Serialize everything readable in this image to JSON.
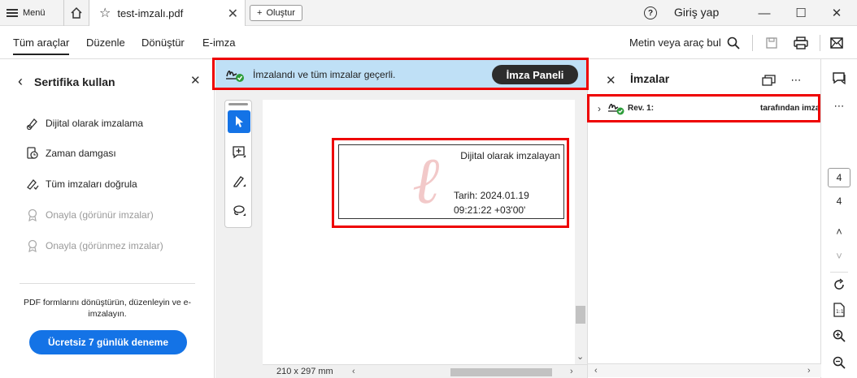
{
  "titlebar": {
    "menu_label": "Menü",
    "tab_title": "test-imzalı.pdf",
    "create_label": "Oluştur",
    "login_label": "Giriş yap"
  },
  "toolbar": {
    "tabs": [
      "Tüm araçlar",
      "Düzenle",
      "Dönüştür",
      "E-imza"
    ],
    "find_label": "Metin veya araç bul"
  },
  "left_panel": {
    "title": "Sertifika kullan",
    "items": [
      {
        "label": "Dijital olarak imzalama",
        "icon": "pen-certificate-icon",
        "enabled": true
      },
      {
        "label": "Zaman damgası",
        "icon": "timestamp-icon",
        "enabled": true
      },
      {
        "label": "Tüm imzaları doğrula",
        "icon": "verify-signature-icon",
        "enabled": true
      },
      {
        "label": "Onayla (görünür imzalar)",
        "icon": "certify-visible-icon",
        "enabled": false
      },
      {
        "label": "Onayla (görünmez imzalar)",
        "icon": "certify-invisible-icon",
        "enabled": false
      }
    ],
    "promo_text": "PDF formlarını dönüştürün, düzenleyin ve e-imzalayın.",
    "trial_button": "Ücretsiz 7 günlük deneme"
  },
  "banner": {
    "message": "İmzalandı ve tüm imzalar geçerli.",
    "button": "İmza Paneli"
  },
  "signature_field": {
    "line1": "Dijital olarak imzalayan",
    "line2": "Tarih: 2024.01.19",
    "line3": "09:21:22 +03'00'"
  },
  "status": {
    "page_size": "210 x 297 mm"
  },
  "signatures_panel": {
    "title": "İmzalar",
    "rev_label": "Rev. 1:",
    "rev_by": "tarafından imzalandı"
  },
  "rail": {
    "current_page": "4",
    "total_pages": "4"
  },
  "colors": {
    "accent": "#1473e6",
    "banner_bg": "#bfe0f6",
    "highlight": "#ee0000",
    "valid_green": "#2d9d3a"
  }
}
